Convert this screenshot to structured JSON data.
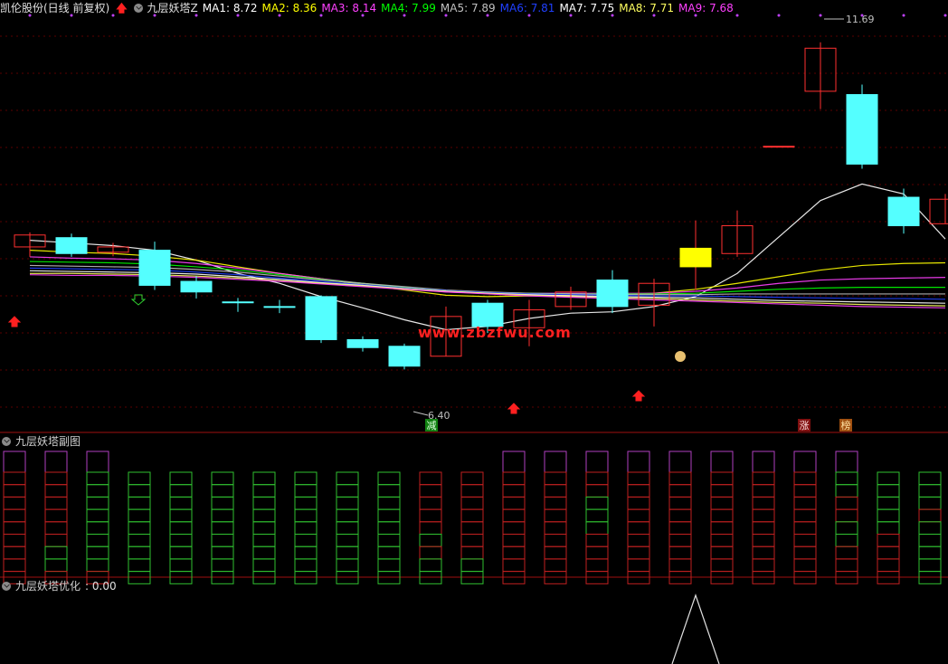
{
  "header": {
    "stock_title": "凯伦股份(日线 前复权)",
    "indicator_name": "九层妖塔Z",
    "ma_values": [
      {
        "label": "MA1: 8.72",
        "color": "#ffffff"
      },
      {
        "label": "MA2: 8.36",
        "color": "#ffff00"
      },
      {
        "label": "MA3: 8.14",
        "color": "#ff40ff"
      },
      {
        "label": "MA4: 7.99",
        "color": "#00ff00"
      },
      {
        "label": "MA5: 7.89",
        "color": "#c0c0c0"
      },
      {
        "label": "MA6: 7.81",
        "color": "#2040ff"
      },
      {
        "label": "MA7: 7.75",
        "color": "#ffffff"
      },
      {
        "label": "MA8: 7.71",
        "color": "#ffff60"
      },
      {
        "label": "MA9: 7.68",
        "color": "#ff40ff"
      }
    ]
  },
  "watermark": "www.zbzfwu.com",
  "annotations": {
    "high_label": "11.69",
    "low_label": "6.40",
    "signal_jian": "减",
    "signal_zhang": "涨",
    "signal_bang": "榜"
  },
  "sub_panel": {
    "title": "九层妖塔副图"
  },
  "bottom_panel": {
    "title": "九层妖塔优化",
    "value": ": 0.00"
  },
  "chart_data": {
    "type": "candlestick",
    "ylim": [
      6.1,
      12.0
    ],
    "candles": [
      {
        "o": 8.6,
        "c": 8.78,
        "h": 8.82,
        "l": 8.45,
        "up": true
      },
      {
        "o": 8.74,
        "c": 8.5,
        "h": 8.8,
        "l": 8.45,
        "up": false
      },
      {
        "o": 8.52,
        "c": 8.6,
        "h": 8.66,
        "l": 8.46,
        "up": true
      },
      {
        "o": 8.55,
        "c": 8.02,
        "h": 8.68,
        "l": 7.95,
        "up": false
      },
      {
        "o": 8.08,
        "c": 7.92,
        "h": 8.16,
        "l": 7.82,
        "up": false
      },
      {
        "o": 7.77,
        "c": 7.77,
        "h": 7.83,
        "l": 7.62,
        "up": false
      },
      {
        "o": 7.7,
        "c": 7.7,
        "h": 7.8,
        "l": 7.6,
        "up": false
      },
      {
        "o": 7.85,
        "c": 7.2,
        "h": 7.87,
        "l": 7.15,
        "up": false
      },
      {
        "o": 7.2,
        "c": 7.08,
        "h": 7.25,
        "l": 7.02,
        "up": false
      },
      {
        "o": 7.1,
        "c": 6.8,
        "h": 7.14,
        "l": 6.75,
        "up": false
      },
      {
        "o": 6.95,
        "c": 7.55,
        "h": 7.7,
        "l": 6.95,
        "up": true
      },
      {
        "o": 7.75,
        "c": 7.4,
        "h": 7.8,
        "l": 7.3,
        "up": false
      },
      {
        "o": 7.38,
        "c": 7.65,
        "h": 7.8,
        "l": 7.1,
        "up": true
      },
      {
        "o": 7.7,
        "c": 7.92,
        "h": 8.0,
        "l": 7.65,
        "up": true
      },
      {
        "o": 8.1,
        "c": 7.7,
        "h": 8.25,
        "l": 7.6,
        "up": false
      },
      {
        "o": 7.72,
        "c": 8.05,
        "h": 8.12,
        "l": 7.4,
        "up": true
      },
      {
        "o": 8.3,
        "c": 8.58,
        "h": 9.0,
        "l": 7.95,
        "up": true
      },
      {
        "o": 8.5,
        "c": 8.92,
        "h": 9.15,
        "l": 8.45,
        "up": true
      },
      {
        "o": 10.12,
        "c": 10.12,
        "h": 10.12,
        "l": 10.12,
        "up": true
      },
      {
        "o": 10.95,
        "c": 11.6,
        "h": 11.69,
        "l": 10.68,
        "up": true
      },
      {
        "o": 10.9,
        "c": 9.85,
        "h": 11.05,
        "l": 9.78,
        "up": false
      },
      {
        "o": 9.35,
        "c": 8.92,
        "h": 9.48,
        "l": 8.8,
        "up": false
      },
      {
        "o": 8.95,
        "c": 9.32,
        "h": 9.4,
        "l": 8.95,
        "up": true
      }
    ],
    "ma_lines": [
      {
        "name": "MA1",
        "color": "#ffffff",
        "values": [
          8.7,
          8.66,
          8.62,
          8.55,
          8.4,
          8.2,
          8.05,
          7.85,
          7.68,
          7.5,
          7.35,
          7.4,
          7.52,
          7.6,
          7.62,
          7.7,
          7.85,
          8.2,
          8.75,
          9.3,
          9.55,
          9.4,
          8.72
        ]
      },
      {
        "name": "MA2",
        "color": "#ffff00",
        "values": [
          8.55,
          8.52,
          8.5,
          8.46,
          8.4,
          8.3,
          8.2,
          8.12,
          8.03,
          7.95,
          7.87,
          7.85,
          7.86,
          7.87,
          7.88,
          7.9,
          7.96,
          8.05,
          8.15,
          8.25,
          8.32,
          8.35,
          8.36
        ]
      },
      {
        "name": "MA3",
        "color": "#ff40ff",
        "values": [
          8.45,
          8.43,
          8.42,
          8.4,
          8.35,
          8.28,
          8.2,
          8.12,
          8.05,
          7.98,
          7.92,
          7.9,
          7.9,
          7.9,
          7.9,
          7.9,
          7.93,
          7.98,
          8.05,
          8.1,
          8.12,
          8.13,
          8.14
        ]
      },
      {
        "name": "MA4",
        "color": "#00ff00",
        "values": [
          8.38,
          8.37,
          8.36,
          8.34,
          8.3,
          8.25,
          8.18,
          8.11,
          8.05,
          7.99,
          7.94,
          7.91,
          7.9,
          7.89,
          7.89,
          7.89,
          7.9,
          7.93,
          7.96,
          7.98,
          7.99,
          7.99,
          7.99
        ]
      },
      {
        "name": "MA5",
        "color": "#c0c0c0",
        "values": [
          8.32,
          8.31,
          8.3,
          8.29,
          8.26,
          8.22,
          8.16,
          8.1,
          8.05,
          8.0,
          7.95,
          7.92,
          7.9,
          7.89,
          7.88,
          7.88,
          7.88,
          7.89,
          7.89,
          7.89,
          7.89,
          7.89,
          7.89
        ]
      },
      {
        "name": "MA6",
        "color": "#2040ff",
        "values": [
          8.28,
          8.27,
          8.26,
          8.25,
          8.22,
          8.18,
          8.13,
          8.08,
          8.03,
          7.98,
          7.94,
          7.91,
          7.89,
          7.88,
          7.87,
          7.86,
          7.86,
          7.85,
          7.84,
          7.83,
          7.82,
          7.82,
          7.81
        ]
      },
      {
        "name": "MA7",
        "color": "#ffffff",
        "values": [
          8.24,
          8.23,
          8.22,
          8.21,
          8.19,
          8.15,
          8.11,
          8.06,
          8.02,
          7.97,
          7.93,
          7.9,
          7.88,
          7.86,
          7.85,
          7.84,
          7.83,
          7.81,
          7.79,
          7.78,
          7.77,
          7.76,
          7.75
        ]
      },
      {
        "name": "MA8",
        "color": "#ffff60",
        "values": [
          8.2,
          8.2,
          8.19,
          8.18,
          8.16,
          8.13,
          8.09,
          8.05,
          8.01,
          7.97,
          7.93,
          7.9,
          7.87,
          7.85,
          7.83,
          7.82,
          7.8,
          7.78,
          7.76,
          7.75,
          7.73,
          7.72,
          7.71
        ]
      },
      {
        "name": "MA9",
        "color": "#ff40ff",
        "values": [
          8.18,
          8.17,
          8.17,
          8.16,
          8.14,
          8.11,
          8.08,
          8.04,
          8.0,
          7.96,
          7.92,
          7.89,
          7.86,
          7.84,
          7.82,
          7.8,
          7.78,
          7.76,
          7.74,
          7.72,
          7.7,
          7.69,
          7.68
        ]
      }
    ],
    "sub_towers": [
      {
        "levels": [
          1,
          0,
          0,
          0,
          0,
          0,
          0,
          0,
          0,
          0
        ],
        "colors": [
          "purple",
          "red",
          "red",
          "red",
          "red",
          "red",
          "red",
          "red",
          "red",
          "red"
        ]
      },
      {
        "levels": [
          1,
          0,
          0,
          0,
          0,
          0,
          0,
          0,
          0,
          0
        ],
        "colors": [
          "purple",
          "red",
          "red",
          "red",
          "red",
          "red",
          "red",
          "green",
          "green",
          "red"
        ]
      },
      {
        "levels": [
          1,
          0,
          0,
          0,
          0,
          0,
          0,
          0,
          0,
          0
        ],
        "colors": [
          "purple",
          "green",
          "green",
          "green",
          "green",
          "green",
          "green",
          "green",
          "green",
          "red"
        ]
      },
      {
        "levels": [
          0,
          0,
          0,
          0,
          0,
          0,
          0,
          0,
          0,
          0
        ],
        "colors": [
          "none",
          "green",
          "green",
          "green",
          "green",
          "green",
          "green",
          "green",
          "green",
          "green"
        ]
      },
      {
        "levels": [
          0,
          0,
          0,
          0,
          0,
          0,
          0,
          0,
          0,
          0
        ],
        "colors": [
          "none",
          "green",
          "green",
          "green",
          "green",
          "green",
          "green",
          "green",
          "green",
          "green"
        ]
      },
      {
        "levels": [
          0,
          0,
          0,
          0,
          0,
          0,
          0,
          0,
          0,
          0
        ],
        "colors": [
          "none",
          "green",
          "green",
          "green",
          "green",
          "green",
          "green",
          "green",
          "green",
          "green"
        ]
      },
      {
        "levels": [
          0,
          0,
          0,
          0,
          0,
          0,
          0,
          0,
          0,
          0
        ],
        "colors": [
          "none",
          "green",
          "green",
          "green",
          "green",
          "green",
          "green",
          "green",
          "green",
          "green"
        ]
      },
      {
        "levels": [
          0,
          0,
          0,
          0,
          0,
          0,
          0,
          0,
          0,
          0
        ],
        "colors": [
          "none",
          "green",
          "green",
          "green",
          "green",
          "green",
          "green",
          "green",
          "green",
          "green"
        ]
      },
      {
        "levels": [
          0,
          0,
          0,
          0,
          0,
          0,
          0,
          0,
          0,
          0
        ],
        "colors": [
          "none",
          "green",
          "green",
          "green",
          "green",
          "green",
          "green",
          "green",
          "green",
          "green"
        ]
      },
      {
        "levels": [
          0,
          0,
          0,
          0,
          0,
          0,
          0,
          0,
          0,
          0
        ],
        "colors": [
          "none",
          "green",
          "green",
          "green",
          "green",
          "green",
          "green",
          "green",
          "green",
          "green"
        ]
      },
      {
        "levels": [
          0,
          0,
          0,
          0,
          0,
          0,
          0,
          0,
          0,
          0
        ],
        "colors": [
          "none",
          "red",
          "red",
          "red",
          "red",
          "red",
          "green",
          "red",
          "green",
          "green"
        ]
      },
      {
        "levels": [
          0,
          0,
          0,
          0,
          0,
          0,
          0,
          0,
          0,
          0
        ],
        "colors": [
          "none",
          "red",
          "red",
          "red",
          "red",
          "red",
          "red",
          "red",
          "green",
          "green"
        ]
      },
      {
        "levels": [
          1,
          0,
          0,
          0,
          0,
          0,
          0,
          0,
          0,
          0
        ],
        "colors": [
          "purple",
          "red",
          "red",
          "red",
          "red",
          "red",
          "red",
          "red",
          "red",
          "red"
        ]
      },
      {
        "levels": [
          1,
          0,
          0,
          0,
          0,
          0,
          0,
          0,
          0,
          0
        ],
        "colors": [
          "purple",
          "red",
          "red",
          "red",
          "red",
          "red",
          "red",
          "red",
          "red",
          "red"
        ]
      },
      {
        "levels": [
          1,
          0,
          0,
          0,
          0,
          0,
          0,
          0,
          0,
          0
        ],
        "colors": [
          "purple",
          "red",
          "red",
          "green",
          "green",
          "green",
          "red",
          "red",
          "red",
          "red"
        ]
      },
      {
        "levels": [
          1,
          0,
          0,
          0,
          0,
          0,
          0,
          0,
          0,
          0
        ],
        "colors": [
          "purple",
          "red",
          "red",
          "red",
          "red",
          "red",
          "red",
          "red",
          "red",
          "red"
        ]
      },
      {
        "levels": [
          1,
          0,
          0,
          0,
          0,
          0,
          0,
          0,
          0,
          0
        ],
        "colors": [
          "purple",
          "red",
          "red",
          "red",
          "red",
          "red",
          "red",
          "red",
          "red",
          "red"
        ]
      },
      {
        "levels": [
          1,
          0,
          0,
          0,
          0,
          0,
          0,
          0,
          0,
          0
        ],
        "colors": [
          "purple",
          "red",
          "red",
          "red",
          "red",
          "red",
          "red",
          "red",
          "red",
          "red"
        ]
      },
      {
        "levels": [
          1,
          0,
          0,
          0,
          0,
          0,
          0,
          0,
          0,
          0
        ],
        "colors": [
          "purple",
          "red",
          "red",
          "red",
          "red",
          "red",
          "red",
          "red",
          "red",
          "red"
        ]
      },
      {
        "levels": [
          1,
          0,
          0,
          0,
          0,
          0,
          0,
          0,
          0,
          0
        ],
        "colors": [
          "purple",
          "red",
          "red",
          "red",
          "red",
          "red",
          "red",
          "red",
          "red",
          "red"
        ]
      },
      {
        "levels": [
          1,
          0,
          0,
          0,
          0,
          0,
          0,
          0,
          0,
          0
        ],
        "colors": [
          "purple",
          "green",
          "green",
          "red",
          "red",
          "green",
          "green",
          "red",
          "red",
          "red"
        ]
      },
      {
        "levels": [
          0,
          0,
          0,
          0,
          0,
          0,
          0,
          0,
          0,
          0
        ],
        "colors": [
          "none",
          "green",
          "green",
          "green",
          "green",
          "green",
          "red",
          "red",
          "red",
          "red"
        ]
      },
      {
        "levels": [
          0,
          0,
          0,
          0,
          0,
          0,
          0,
          0,
          0,
          0
        ],
        "colors": [
          "none",
          "green",
          "green",
          "green",
          "red",
          "green",
          "green",
          "green",
          "green",
          "green"
        ]
      }
    ],
    "bottom_spike": {
      "index": 16,
      "value": 1
    }
  },
  "colors": {
    "up": "#ff3030",
    "down": "#54ffff",
    "grid": "#800000",
    "purple": "#b040c0",
    "red": "#c02020",
    "green": "#30c030"
  }
}
